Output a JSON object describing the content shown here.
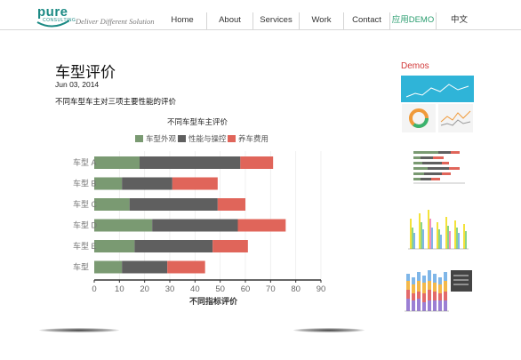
{
  "brand": {
    "logo_word": "pure",
    "logo_sub": "CONSULTING",
    "tagline": "Deliver Different Solution"
  },
  "nav": {
    "items": [
      {
        "label": "Home"
      },
      {
        "label": "About"
      },
      {
        "label": "Services"
      },
      {
        "label": "Work"
      },
      {
        "label": "Contact"
      },
      {
        "label": "应用DEMO"
      },
      {
        "label": "中文"
      }
    ]
  },
  "post": {
    "title": "车型评价",
    "date": "Jun 03, 2014",
    "description": "不同车型车主对三项主要性能的评价"
  },
  "sidebar": {
    "demos_title": "Demos"
  },
  "colors": {
    "accent": "#2a9d6f",
    "demos_red": "#d23a3a",
    "series": [
      "#7a9a72",
      "#5f5f5f",
      "#e0655a"
    ]
  },
  "chart_data": {
    "type": "bar",
    "orientation": "horizontal",
    "stacked": true,
    "title": "不同车型车主评价",
    "xlabel": "不同指标评价",
    "ylabel": "",
    "categories": [
      "车型 A",
      "车型 B",
      "车型 C",
      "车型 D",
      "车型 E",
      "车型 F"
    ],
    "category_labels_visible": [
      "车型 A",
      "车型 B",
      "车型 C",
      "车型 D",
      "车型 E",
      "车型"
    ],
    "series": [
      {
        "name": "车型外观",
        "values": [
          18,
          11,
          14,
          23,
          16,
          11
        ]
      },
      {
        "name": "性能与操控",
        "values": [
          40,
          20,
          35,
          34,
          31,
          18
        ]
      },
      {
        "name": "养车费用",
        "values": [
          13,
          18,
          11,
          19,
          14,
          15
        ]
      }
    ],
    "xlim": [
      0,
      90
    ],
    "xticks": [
      0,
      10,
      20,
      30,
      40,
      50,
      60,
      70,
      80,
      90
    ],
    "legend_position": "top",
    "grid": true
  }
}
